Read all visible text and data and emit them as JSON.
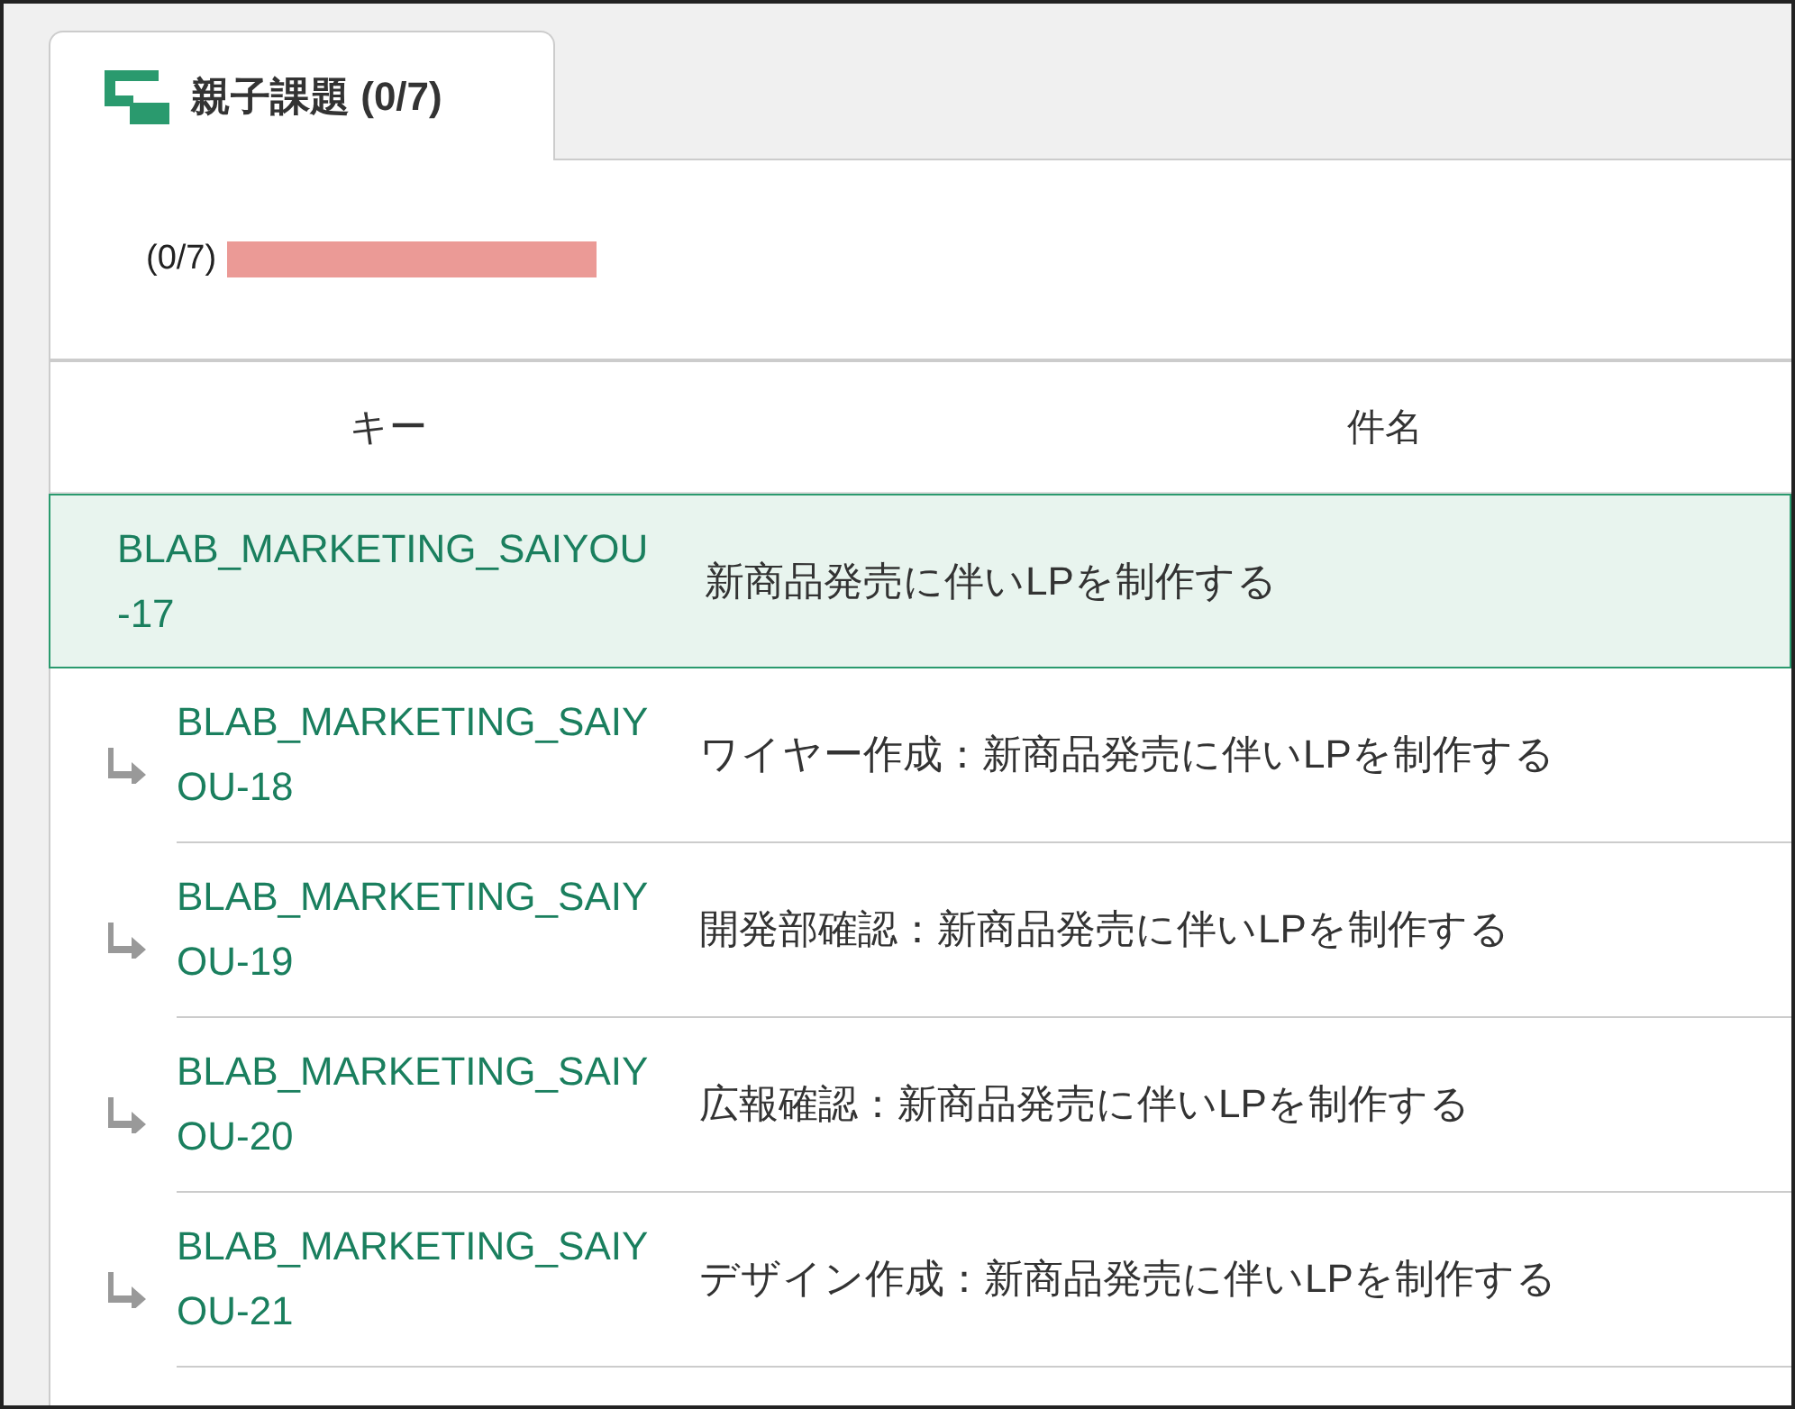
{
  "tab": {
    "label": "親子課題 (0/7)",
    "selected": true
  },
  "progress": {
    "reading": "(0/7)",
    "level": 0
  },
  "table": {
    "columns": [
      "キー",
      "件名"
    ],
    "rows": [
      {
        "key": "BLAB_MARKETING_SAIYOU-17",
        "subject": "新商品発売に伴いLPを制作する",
        "selected": true,
        "children": [
          {
            "key": "BLAB_MARKETING_SAIYOU-18",
            "subject": "ワイヤー作成：新商品発売に伴いLPを制作する",
            "selected": false
          },
          {
            "key": "BLAB_MARKETING_SAIYOU-19",
            "subject": "開発部確認：新商品発売に伴いLPを制作する",
            "selected": false
          },
          {
            "key": "BLAB_MARKETING_SAIYOU-20",
            "subject": "広報確認：新商品発売に伴いLPを制作する",
            "selected": false
          },
          {
            "key": "BLAB_MARKETING_SAIYOU-21",
            "subject": "デザイン作成：新商品発売に伴いLPを制作する",
            "selected": false
          }
        ]
      }
    ]
  }
}
